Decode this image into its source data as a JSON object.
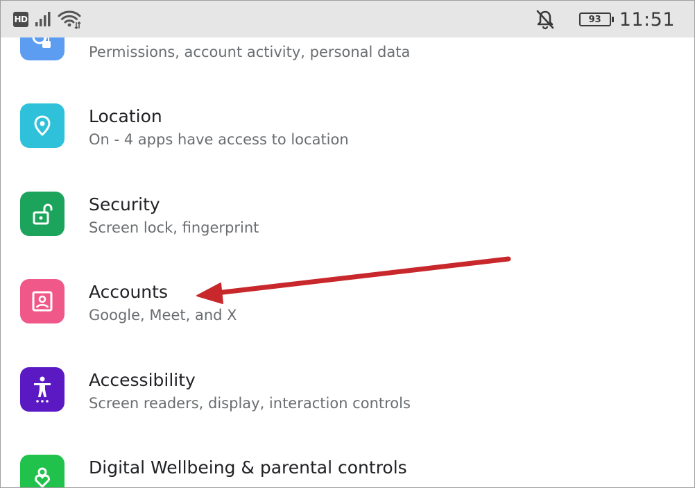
{
  "status_bar": {
    "network_badge": "HD",
    "signal_icon": "cell-signal-icon",
    "wifi_icon": "wifi-icon",
    "notifications_icon": "notifications-off-icon",
    "battery_level": "93",
    "time": "11:51"
  },
  "settings": {
    "items": [
      {
        "id": "privacy",
        "title": "",
        "subtitle": "Permissions, account activity, personal data",
        "icon": "privacy-icon",
        "color": "#5c9df2"
      },
      {
        "id": "location",
        "title": "Location",
        "subtitle": "On - 4 apps have access to location",
        "icon": "location-pin-icon",
        "color": "#2fc1da"
      },
      {
        "id": "security",
        "title": "Security",
        "subtitle": "Screen lock, fingerprint",
        "icon": "unlock-icon",
        "color": "#1ca45c"
      },
      {
        "id": "accounts",
        "title": "Accounts",
        "subtitle": "Google, Meet, and X",
        "icon": "account-box-icon",
        "color": "#f0588a"
      },
      {
        "id": "accessibility",
        "title": "Accessibility",
        "subtitle": "Screen readers, display, interaction controls",
        "icon": "accessibility-icon",
        "color": "#5b19c4"
      },
      {
        "id": "digital-wellbeing",
        "title": "Digital Wellbeing & parental controls",
        "subtitle": "",
        "icon": "wellbeing-icon",
        "color": "#21c24b"
      }
    ]
  },
  "annotation": {
    "arrow_color": "#c8282b",
    "target": "Accounts"
  }
}
